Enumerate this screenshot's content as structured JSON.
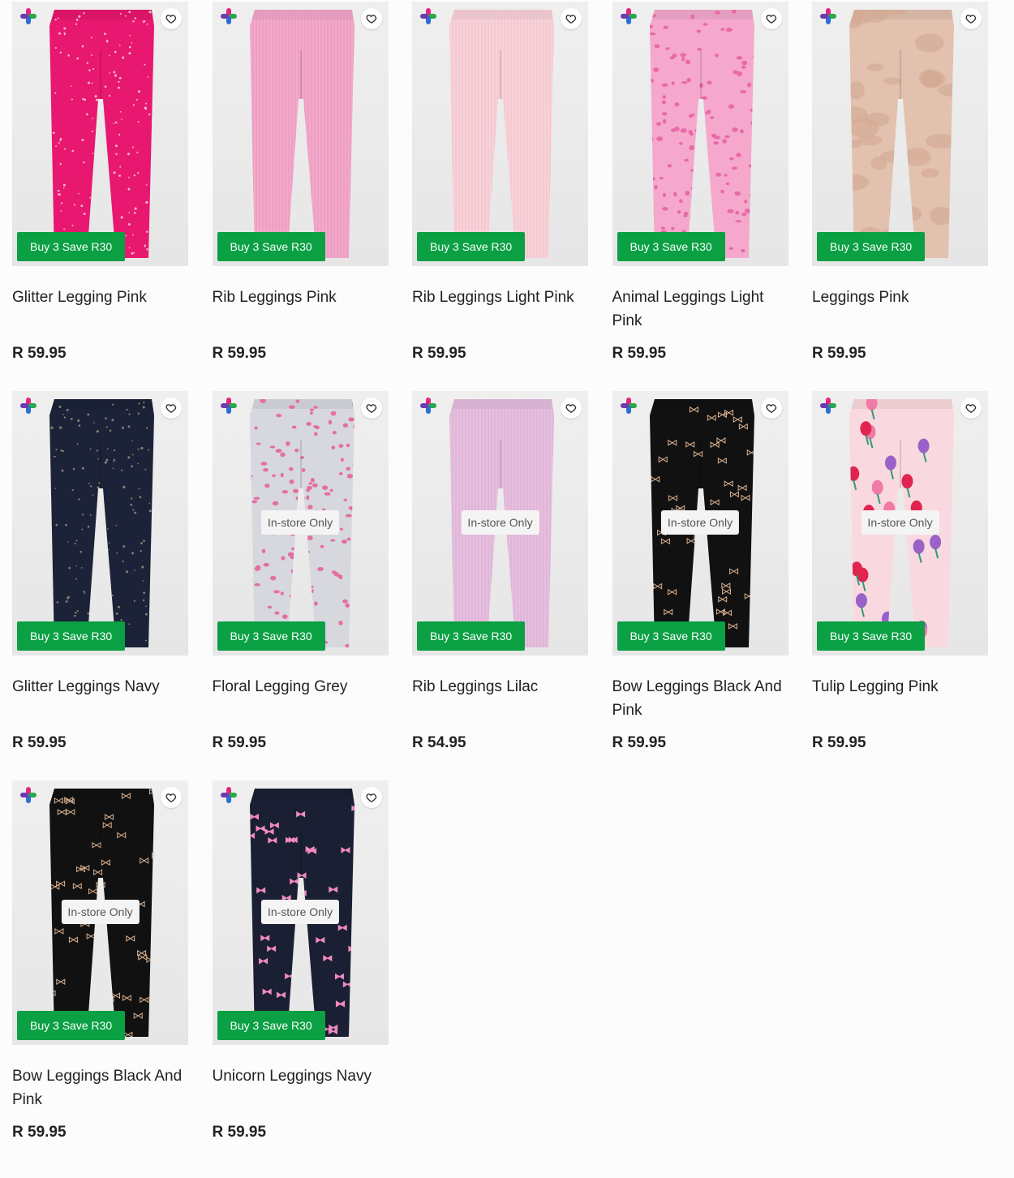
{
  "products": [
    {
      "name": "Glitter Legging Pink",
      "price": "R 59.95",
      "promo": "Buy 3 Save R30",
      "in_store": "",
      "color": "#e8176f",
      "pattern": "glitter",
      "patternColor": "#f5b3cf"
    },
    {
      "name": "Rib Leggings Pink",
      "price": "R 59.95",
      "promo": "Buy 3 Save R30",
      "in_store": "",
      "color": "#f2a9ca",
      "pattern": "rib",
      "patternColor": "#e995bb"
    },
    {
      "name": "Rib Leggings Light Pink",
      "price": "R 59.95",
      "promo": "Buy 3 Save R30",
      "in_store": "",
      "color": "#f8d2d9",
      "pattern": "rib",
      "patternColor": "#f0c0ca"
    },
    {
      "name": "Animal Leggings Light Pink",
      "price": "R 59.95",
      "promo": "Buy 3 Save R30",
      "in_store": "",
      "color": "#f5a8cc",
      "pattern": "spots",
      "patternColor": "#e86aa6"
    },
    {
      "name": "Leggings Pink",
      "price": "R 59.95",
      "promo": "Buy 3 Save R30",
      "in_store": "",
      "color": "#e2c1ae",
      "pattern": "foil",
      "patternColor": "#d4a992"
    },
    {
      "name": "Glitter Leggings Navy",
      "price": "R 59.95",
      "promo": "Buy 3 Save R30",
      "in_store": "",
      "color": "#1c2238",
      "pattern": "glitter",
      "patternColor": "#8a7f6e"
    },
    {
      "name": "Floral Legging Grey",
      "price": "R 59.95",
      "promo": "Buy 3 Save R30",
      "in_store": "In-store Only",
      "color": "#d6d8de",
      "pattern": "spots",
      "patternColor": "#e46fa0"
    },
    {
      "name": "Rib Leggings Lilac",
      "price": "R 54.95",
      "promo": "Buy 3 Save R30",
      "in_store": "In-store Only",
      "color": "#e6bfdf",
      "pattern": "rib",
      "patternColor": "#d9aed2"
    },
    {
      "name": "Bow Leggings Black And Pink",
      "price": "R 59.95",
      "promo": "Buy 3 Save R30",
      "in_store": "In-store Only",
      "color": "#111111",
      "pattern": "bows",
      "patternColor": "#d9b08f"
    },
    {
      "name": "Tulip Legging Pink",
      "price": "R 59.95",
      "promo": "Buy 3 Save R30",
      "in_store": "In-store Only",
      "color": "#f9d9df",
      "pattern": "tulips",
      "patternColor": "#e1244f"
    },
    {
      "name": "Bow Leggings Black And Pink",
      "price": "R 59.95",
      "promo": "Buy 3 Save R30",
      "in_store": "In-store Only",
      "color": "#111111",
      "pattern": "bows",
      "patternColor": "#d9b08f"
    },
    {
      "name": "Unicorn Leggings Navy",
      "price": "R 59.95",
      "promo": "Buy 3 Save R30",
      "in_store": "In-store Only",
      "color": "#1a1f33",
      "pattern": "unicorn",
      "patternColor": "#f08ac0"
    }
  ],
  "icons": {
    "brand": "plus-logo-icon",
    "wishlist": "heart-icon"
  },
  "colors": {
    "promo_bg": "#0aa043",
    "page_bg": "#fcfcfc"
  }
}
